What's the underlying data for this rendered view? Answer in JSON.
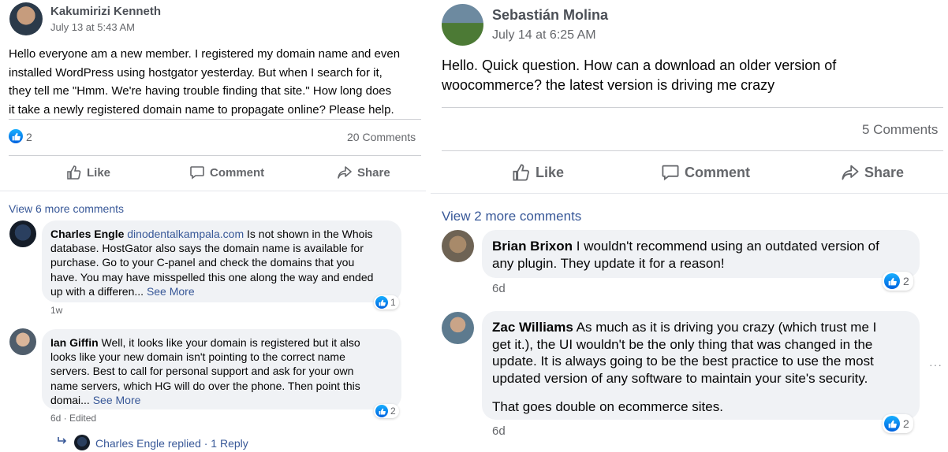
{
  "left": {
    "author": "Kakumirizi Kenneth",
    "time": "July 13 at 5:43 AM",
    "body_lines": [
      "Hello everyone am a new member. I registered my domain name and even",
      "installed WordPress using hostgator yesterday. But when I search for it,",
      "they tell me \"Hmm. We're having trouble finding that site.\" How long does",
      "it take a newly registered domain name to propagate online? Please help."
    ],
    "reaction_count": "2",
    "comment_count": "20 Comments",
    "actions": {
      "like": "Like",
      "comment": "Comment",
      "share": "Share"
    },
    "view_more": "View 6 more comments",
    "comments": [
      {
        "name": "Charles Engle",
        "link": "dinodentalkampala.com",
        "lines": [
          " Is not shown in the Whois",
          "database. HostGator also says the domain name is available for",
          "purchase. Go to your C-panel and check the domains that you",
          "have. You may have misspelled this one along the way and ended",
          "up with a differen... "
        ],
        "see_more": "See More",
        "reactions": "1",
        "meta": "1w"
      },
      {
        "name": "Ian Giffin",
        "lines": [
          " Well, it looks like your domain is registered but it also",
          "looks like your new domain isn't pointing to the correct name",
          "servers. Best to call for personal support and ask for your own",
          "name servers, which HG will do over the phone. Then point this",
          "domai... "
        ],
        "see_more": "See More",
        "reactions": "2",
        "meta": "6d · Edited"
      }
    ],
    "reply_text": "Charles Engle replied · 1 Reply"
  },
  "right": {
    "author": "Sebastián Molina",
    "time": "July 14 at 6:25 AM",
    "body_lines": [
      "Hello. Quick question. How can a download an older version of",
      "woocommerce? the latest version is driving me crazy"
    ],
    "comment_count": "5 Comments",
    "actions": {
      "like": "Like",
      "comment": "Comment",
      "share": "Share"
    },
    "view_more": "View 2 more comments",
    "comments": [
      {
        "name": "Brian Brixon",
        "lines": [
          " I wouldn't recommend using an outdated version of",
          "any plugin. They update it for a reason!"
        ],
        "reactions": "2",
        "meta": "6d"
      },
      {
        "name": "Zac Williams",
        "lines": [
          " As much as it is driving you crazy (which trust me I",
          "get it.), the UI wouldn't be the only thing that was changed in the",
          "update. It is always going to be the best practice to use the most",
          "updated version of any software to maintain your site's security."
        ],
        "extra": "That goes double on ecommerce sites.",
        "reactions": "2",
        "meta": "6d",
        "more_icon": "···"
      }
    ]
  }
}
